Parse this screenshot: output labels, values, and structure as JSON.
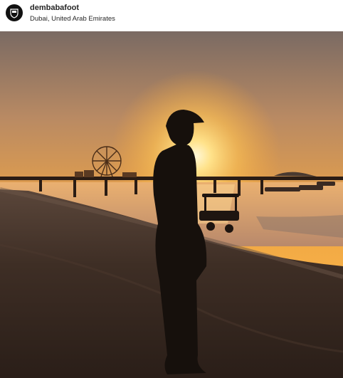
{
  "header": {
    "username": "dembabafoot",
    "location": "Dubai, United Arab Emirates"
  },
  "avatar": {
    "icon": "team-crest-icon"
  },
  "photo": {
    "scene": "sunset-beach-silhouette"
  },
  "colors": {
    "sky_top": "#7a6a63",
    "sky_glow": "#f5a53a",
    "sun": "#fff3c4",
    "water": "#e9a06a",
    "sand": "#3b2b22",
    "silhouette": "#16100c"
  }
}
